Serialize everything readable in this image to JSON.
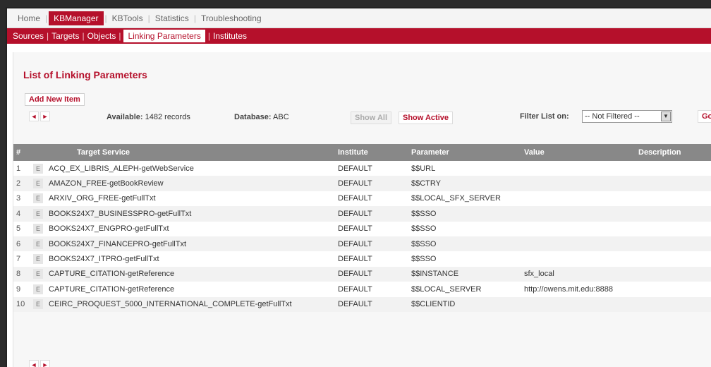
{
  "topnav": {
    "items": [
      {
        "label": "Home",
        "active": false
      },
      {
        "label": "KBManager",
        "active": true
      },
      {
        "label": "KBTools",
        "active": false
      },
      {
        "label": "Statistics",
        "active": false
      },
      {
        "label": "Troubleshooting",
        "active": false
      }
    ]
  },
  "subnav": {
    "items": [
      {
        "label": "Sources"
      },
      {
        "label": "Targets"
      },
      {
        "label": "Objects"
      },
      {
        "label": "Linking Parameters",
        "active": true
      },
      {
        "label": "Institutes"
      }
    ]
  },
  "main": {
    "title": "List of Linking Parameters",
    "add_label": "Add New Item",
    "pager": {
      "prev_icon": "◄",
      "next_icon": "►"
    },
    "available_label": "Available:",
    "available_value": "1482 records",
    "database_label": "Database:",
    "database_value": "ABC",
    "show_all_label": "Show All",
    "show_active_label": "Show Active",
    "filter_label": "Filter List on:",
    "filter_value": "-- Not Filtered --",
    "go_label": "Go"
  },
  "table": {
    "headers": {
      "num": "#",
      "target": "Target Service",
      "institute": "Institute",
      "parameter": "Parameter",
      "value": "Value",
      "description": "Description"
    },
    "edit_label": "E",
    "rows": [
      {
        "num": "1",
        "target": "ACQ_EX_LIBRIS_ALEPH-getWebService",
        "institute": "DEFAULT",
        "parameter": "$$URL",
        "value": ""
      },
      {
        "num": "2",
        "target": "AMAZON_FREE-getBookReview",
        "institute": "DEFAULT",
        "parameter": "$$CTRY",
        "value": ""
      },
      {
        "num": "3",
        "target": "ARXIV_ORG_FREE-getFullTxt",
        "institute": "DEFAULT",
        "parameter": "$$LOCAL_SFX_SERVER",
        "value": ""
      },
      {
        "num": "4",
        "target": "BOOKS24X7_BUSINESSPRO-getFullTxt",
        "institute": "DEFAULT",
        "parameter": "$$SSO",
        "value": ""
      },
      {
        "num": "5",
        "target": "BOOKS24X7_ENGPRO-getFullTxt",
        "institute": "DEFAULT",
        "parameter": "$$SSO",
        "value": ""
      },
      {
        "num": "6",
        "target": "BOOKS24X7_FINANCEPRO-getFullTxt",
        "institute": "DEFAULT",
        "parameter": "$$SSO",
        "value": ""
      },
      {
        "num": "7",
        "target": "BOOKS24X7_ITPRO-getFullTxt",
        "institute": "DEFAULT",
        "parameter": "$$SSO",
        "value": ""
      },
      {
        "num": "8",
        "target": "CAPTURE_CITATION-getReference",
        "institute": "DEFAULT",
        "parameter": "$$INSTANCE",
        "value": "sfx_local"
      },
      {
        "num": "9",
        "target": "CAPTURE_CITATION-getReference",
        "institute": "DEFAULT",
        "parameter": "$$LOCAL_SERVER",
        "value": "http://owens.mit.edu:8888"
      },
      {
        "num": "10",
        "target": "CEIRC_PROQUEST_5000_INTERNATIONAL_COMPLETE-getFullTxt",
        "institute": "DEFAULT",
        "parameter": "$$CLIENTID",
        "value": ""
      }
    ]
  },
  "colors": {
    "accent": "#b5102b",
    "header_bg": "#888888"
  }
}
